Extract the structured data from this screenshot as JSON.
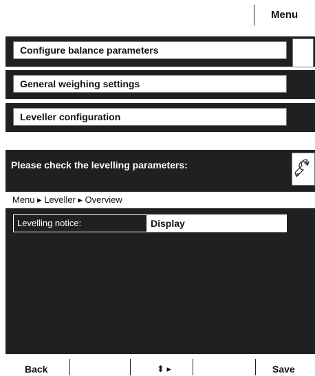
{
  "header": {
    "menu_label": "Menu"
  },
  "menu_items": [
    {
      "label": "Configure balance parameters"
    },
    {
      "label": "General weighing settings"
    },
    {
      "label": "Leveller configuration"
    }
  ],
  "panel": {
    "title": "Please check the levelling parameters:",
    "breadcrumb": "Menu ▸ Leveller ▸ Overview",
    "row": {
      "label": "Levelling notice:",
      "value": "Display"
    }
  },
  "softkeys": {
    "back": "Back",
    "nav": "⬍ ▸",
    "save": "Save"
  }
}
